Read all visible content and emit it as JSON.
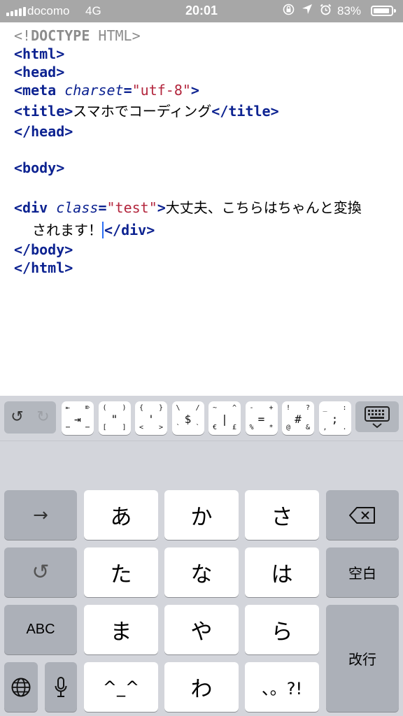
{
  "status_bar": {
    "carrier": "docomo",
    "network": "4G",
    "time": "20:01",
    "battery_percent": "83%",
    "battery_level": 0.83,
    "icons": [
      "orientation-lock-icon",
      "location-arrow-icon",
      "alarm-icon"
    ]
  },
  "editor": {
    "doctype": {
      "open": "<!",
      "keyword": "DOCTYPE",
      "rest": " HTML",
      "close": ">"
    },
    "html_open": "<html>",
    "head_open": "<head>",
    "meta": {
      "open": "<meta",
      "attr": "charset",
      "eq": "=",
      "value": "\"utf-8\"",
      "close": ">"
    },
    "title": {
      "open": "<title>",
      "text": "スマホでコーディング",
      "close": "</title>"
    },
    "head_close": "</head>",
    "body_open": "<body>",
    "div": {
      "open": "<div",
      "attr": "class",
      "eq": "=",
      "value": "\"test\"",
      "gt": ">",
      "text_line1": "大丈夫、こちらはちゃんと変換",
      "text_line2": "されます！",
      "close": "</div>"
    },
    "body_close": "</body>",
    "html_close": "</html>"
  },
  "toolbar": {
    "undo": "↺",
    "redo": "↻",
    "symbol_keys": [
      {
        "tl": "⇤",
        "tr": "⌦",
        "m": "⇥",
        "bl": "⋯",
        "br": "⋯"
      },
      {
        "tl": "(",
        "tr": ")",
        "m": "\"",
        "bl": "[",
        "br": "]"
      },
      {
        "tl": "{",
        "tr": "}",
        "m": "'",
        "bl": "<",
        "br": ">"
      },
      {
        "tl": "\\",
        "tr": "/",
        "m": "$",
        "bl": "`",
        "br": "`"
      },
      {
        "tl": "~",
        "tr": "^",
        "m": "|",
        "bl": "€",
        "br": "£"
      },
      {
        "tl": "-",
        "tr": "+",
        "m": "=",
        "bl": "%",
        "br": "*"
      },
      {
        "tl": "!",
        "tr": "?",
        "m": "#",
        "bl": "@",
        "br": "&"
      },
      {
        "tl": "_",
        "tr": ":",
        "m": ";",
        "bl": ",",
        "br": "."
      }
    ]
  },
  "keyboard": {
    "row1": {
      "arrow": "→",
      "a": "あ",
      "ka": "か",
      "sa": "さ"
    },
    "row2": {
      "undo": "↺",
      "ta": "た",
      "na": "な",
      "ha": "は",
      "space": "空白"
    },
    "row3": {
      "abc": "ABC",
      "ma": "ま",
      "ya": "や",
      "ra": "ら",
      "enter": "改行"
    },
    "row4": {
      "emoticon": "^_^",
      "wa": "わ",
      "punct": "、。?!"
    }
  }
}
